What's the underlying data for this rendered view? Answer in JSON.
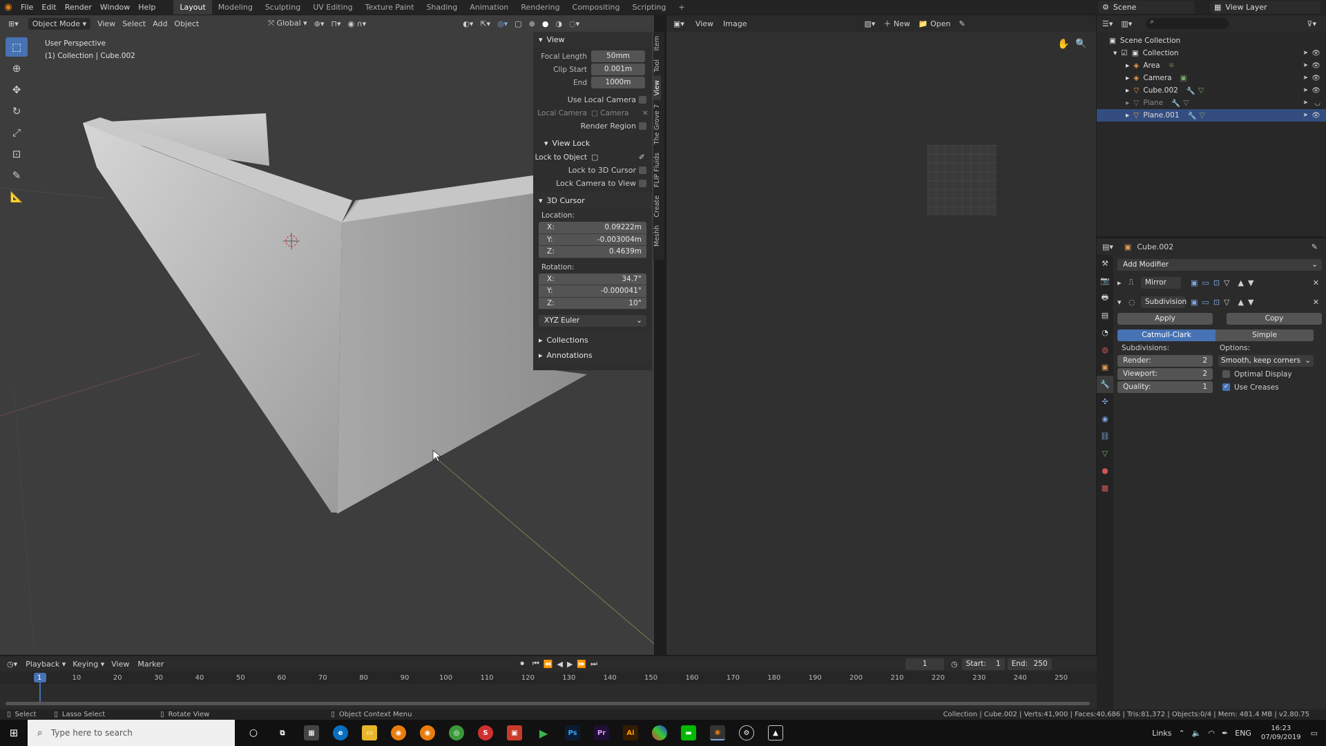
{
  "menubar": {
    "items": [
      "File",
      "Edit",
      "Render",
      "Window",
      "Help"
    ],
    "workspaces": [
      "Layout",
      "Modeling",
      "Sculpting",
      "UV Editing",
      "Texture Paint",
      "Shading",
      "Animation",
      "Rendering",
      "Compositing",
      "Scripting"
    ],
    "active_workspace": "Layout",
    "add_ws": "+",
    "scene": "Scene",
    "view_layer": "View Layer"
  },
  "viewport": {
    "mode": "Object Mode",
    "menus": [
      "View",
      "Select",
      "Add",
      "Object"
    ],
    "orientation": "Global",
    "overlay_title": "User Perspective",
    "overlay_sub": "(1) Collection | Cube.002"
  },
  "npanel": {
    "view_header": "View",
    "focal_length_label": "Focal Length",
    "focal_length": "50mm",
    "clip_start_label": "Clip Start",
    "clip_start": "0.001m",
    "end_label": "End",
    "clip_end": "1000m",
    "use_local_camera": "Use Local Camera",
    "local_camera_label": "Local Camera",
    "local_camera_value": "Camera",
    "render_region": "Render Region",
    "view_lock_header": "View Lock",
    "lock_to_object": "Lock to Object",
    "lock_to_cursor": "Lock to 3D Cursor",
    "lock_camera": "Lock Camera to View",
    "cursor_header": "3D Cursor",
    "location_label": "Location:",
    "loc": [
      {
        "axis": "X:",
        "val": "0.09222m"
      },
      {
        "axis": "Y:",
        "val": "-0.003004m"
      },
      {
        "axis": "Z:",
        "val": "0.4639m"
      }
    ],
    "rotation_label": "Rotation:",
    "rot": [
      {
        "axis": "X:",
        "val": "34.7°"
      },
      {
        "axis": "Y:",
        "val": "-0.000041°"
      },
      {
        "axis": "Z:",
        "val": "10°"
      }
    ],
    "rotation_mode": "XYZ Euler",
    "collections": "Collections",
    "annotations": "Annotations",
    "tabs": [
      "Item",
      "Tool",
      "View",
      "The Grove 7",
      "FLIP Fluids",
      "Create",
      "Meshh"
    ]
  },
  "image_editor": {
    "menus": [
      "View",
      "Image"
    ],
    "new_label": "New",
    "open_label": "Open"
  },
  "outliner": {
    "root": "Scene Collection",
    "collection": "Collection",
    "items": [
      {
        "name": "Area",
        "icon_color": "#e29b58"
      },
      {
        "name": "Camera",
        "icon_color": "#e29b58"
      },
      {
        "name": "Cube.002",
        "icon_color": "#e29b58"
      },
      {
        "name": "Plane",
        "icon_color": "#e29b58"
      },
      {
        "name": "Plane.001",
        "icon_color": "#e29b58"
      }
    ],
    "selected": "Plane.001"
  },
  "properties": {
    "object_name": "Cube.002",
    "add_modifier": "Add Modifier",
    "mirror": "Mirror",
    "subdivision": "Subdivision",
    "apply": "Apply",
    "copy": "Copy",
    "catmull": "Catmull-Clark",
    "simple": "Simple",
    "subdivisions_label": "Subdivisions:",
    "options_label": "Options:",
    "render_label": "Render:",
    "render_val": "2",
    "viewport_label": "Viewport:",
    "viewport_val": "2",
    "quality_label": "Quality:",
    "quality_val": "1",
    "uv_option": "Smooth, keep corners",
    "optimal_display": "Optimal Display",
    "use_creases": "Use Creases"
  },
  "timeline": {
    "menus": [
      "Playback",
      "Keying",
      "View",
      "Marker"
    ],
    "current_frame": "1",
    "start_label": "Start:",
    "start": "1",
    "end_label": "End:",
    "end": "250",
    "ticks": [
      "1",
      "10",
      "20",
      "30",
      "40",
      "50",
      "60",
      "70",
      "80",
      "90",
      "100",
      "110",
      "120",
      "130",
      "140",
      "150",
      "160",
      "170",
      "180",
      "190",
      "200",
      "210",
      "220",
      "230",
      "240",
      "250"
    ]
  },
  "statusbar": {
    "select": "Select",
    "lasso": "Lasso Select",
    "rotate": "Rotate View",
    "context": "Object Context Menu",
    "stats": "Collection | Cube.002 | Verts:41,900 | Faces:40,686 | Tris:81,372 | Objects:0/4 | Mem: 481.4 MB | v2.80.75"
  },
  "taskbar": {
    "search_placeholder": "Type here to search",
    "links": "Links",
    "lang": "ENG",
    "time": "16:23",
    "date": "07/09/2019"
  },
  "colors": {
    "accent": "#4772b3",
    "selected_row": "#334d80"
  }
}
